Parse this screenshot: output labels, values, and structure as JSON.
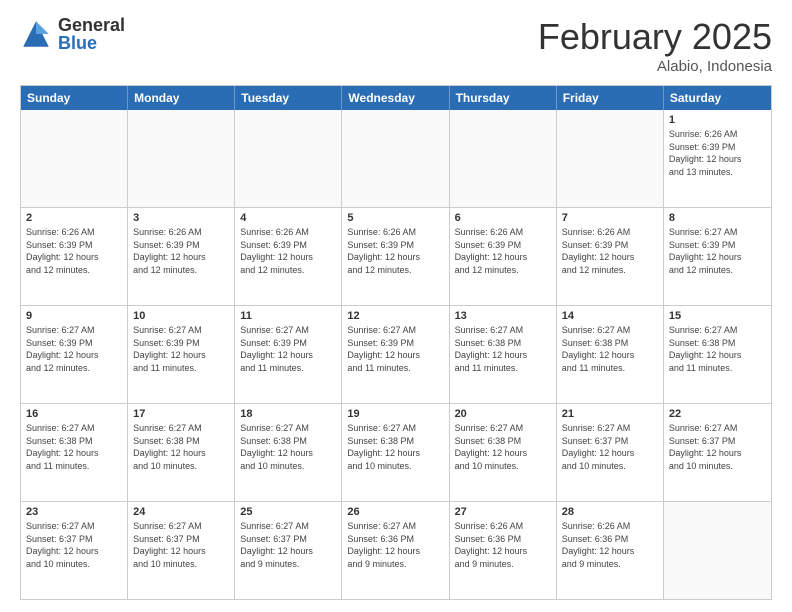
{
  "logo": {
    "general": "General",
    "blue": "Blue"
  },
  "title": "February 2025",
  "subtitle": "Alabio, Indonesia",
  "header_days": [
    "Sunday",
    "Monday",
    "Tuesday",
    "Wednesday",
    "Thursday",
    "Friday",
    "Saturday"
  ],
  "weeks": [
    [
      {
        "day": "",
        "empty": true
      },
      {
        "day": "",
        "empty": true
      },
      {
        "day": "",
        "empty": true
      },
      {
        "day": "",
        "empty": true
      },
      {
        "day": "",
        "empty": true
      },
      {
        "day": "",
        "empty": true
      },
      {
        "day": "1",
        "info": "Sunrise: 6:26 AM\nSunset: 6:39 PM\nDaylight: 12 hours\nand 13 minutes."
      }
    ],
    [
      {
        "day": "2",
        "info": "Sunrise: 6:26 AM\nSunset: 6:39 PM\nDaylight: 12 hours\nand 12 minutes."
      },
      {
        "day": "3",
        "info": "Sunrise: 6:26 AM\nSunset: 6:39 PM\nDaylight: 12 hours\nand 12 minutes."
      },
      {
        "day": "4",
        "info": "Sunrise: 6:26 AM\nSunset: 6:39 PM\nDaylight: 12 hours\nand 12 minutes."
      },
      {
        "day": "5",
        "info": "Sunrise: 6:26 AM\nSunset: 6:39 PM\nDaylight: 12 hours\nand 12 minutes."
      },
      {
        "day": "6",
        "info": "Sunrise: 6:26 AM\nSunset: 6:39 PM\nDaylight: 12 hours\nand 12 minutes."
      },
      {
        "day": "7",
        "info": "Sunrise: 6:26 AM\nSunset: 6:39 PM\nDaylight: 12 hours\nand 12 minutes."
      },
      {
        "day": "8",
        "info": "Sunrise: 6:27 AM\nSunset: 6:39 PM\nDaylight: 12 hours\nand 12 minutes."
      }
    ],
    [
      {
        "day": "9",
        "info": "Sunrise: 6:27 AM\nSunset: 6:39 PM\nDaylight: 12 hours\nand 12 minutes."
      },
      {
        "day": "10",
        "info": "Sunrise: 6:27 AM\nSunset: 6:39 PM\nDaylight: 12 hours\nand 11 minutes."
      },
      {
        "day": "11",
        "info": "Sunrise: 6:27 AM\nSunset: 6:39 PM\nDaylight: 12 hours\nand 11 minutes."
      },
      {
        "day": "12",
        "info": "Sunrise: 6:27 AM\nSunset: 6:39 PM\nDaylight: 12 hours\nand 11 minutes."
      },
      {
        "day": "13",
        "info": "Sunrise: 6:27 AM\nSunset: 6:38 PM\nDaylight: 12 hours\nand 11 minutes."
      },
      {
        "day": "14",
        "info": "Sunrise: 6:27 AM\nSunset: 6:38 PM\nDaylight: 12 hours\nand 11 minutes."
      },
      {
        "day": "15",
        "info": "Sunrise: 6:27 AM\nSunset: 6:38 PM\nDaylight: 12 hours\nand 11 minutes."
      }
    ],
    [
      {
        "day": "16",
        "info": "Sunrise: 6:27 AM\nSunset: 6:38 PM\nDaylight: 12 hours\nand 11 minutes."
      },
      {
        "day": "17",
        "info": "Sunrise: 6:27 AM\nSunset: 6:38 PM\nDaylight: 12 hours\nand 10 minutes."
      },
      {
        "day": "18",
        "info": "Sunrise: 6:27 AM\nSunset: 6:38 PM\nDaylight: 12 hours\nand 10 minutes."
      },
      {
        "day": "19",
        "info": "Sunrise: 6:27 AM\nSunset: 6:38 PM\nDaylight: 12 hours\nand 10 minutes."
      },
      {
        "day": "20",
        "info": "Sunrise: 6:27 AM\nSunset: 6:38 PM\nDaylight: 12 hours\nand 10 minutes."
      },
      {
        "day": "21",
        "info": "Sunrise: 6:27 AM\nSunset: 6:37 PM\nDaylight: 12 hours\nand 10 minutes."
      },
      {
        "day": "22",
        "info": "Sunrise: 6:27 AM\nSunset: 6:37 PM\nDaylight: 12 hours\nand 10 minutes."
      }
    ],
    [
      {
        "day": "23",
        "info": "Sunrise: 6:27 AM\nSunset: 6:37 PM\nDaylight: 12 hours\nand 10 minutes."
      },
      {
        "day": "24",
        "info": "Sunrise: 6:27 AM\nSunset: 6:37 PM\nDaylight: 12 hours\nand 10 minutes."
      },
      {
        "day": "25",
        "info": "Sunrise: 6:27 AM\nSunset: 6:37 PM\nDaylight: 12 hours\nand 9 minutes."
      },
      {
        "day": "26",
        "info": "Sunrise: 6:27 AM\nSunset: 6:36 PM\nDaylight: 12 hours\nand 9 minutes."
      },
      {
        "day": "27",
        "info": "Sunrise: 6:26 AM\nSunset: 6:36 PM\nDaylight: 12 hours\nand 9 minutes."
      },
      {
        "day": "28",
        "info": "Sunrise: 6:26 AM\nSunset: 6:36 PM\nDaylight: 12 hours\nand 9 minutes."
      },
      {
        "day": "",
        "empty": true
      }
    ]
  ]
}
